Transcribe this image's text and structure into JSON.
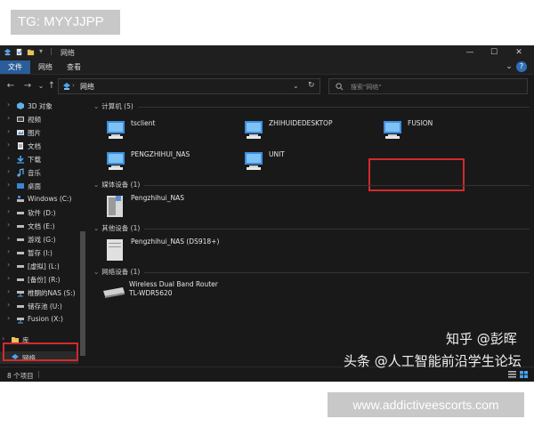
{
  "overlay": {
    "tg_label": "TG: MYYJJPP",
    "url_label": "www.addictiveescorts.com"
  },
  "window": {
    "title": "网络",
    "tabs": [
      "文件",
      "网络",
      "查看"
    ],
    "active_tab": 0
  },
  "address": {
    "crumb": "网络",
    "search_placeholder": "搜索\"网络\""
  },
  "sidebar": {
    "items": [
      {
        "label": "3D 对象",
        "icon": "3d-objects-icon"
      },
      {
        "label": "视频",
        "icon": "video-icon"
      },
      {
        "label": "图片",
        "icon": "pictures-icon"
      },
      {
        "label": "文档",
        "icon": "documents-icon"
      },
      {
        "label": "下载",
        "icon": "downloads-icon"
      },
      {
        "label": "音乐",
        "icon": "music-icon"
      },
      {
        "label": "桌面",
        "icon": "desktop-icon"
      },
      {
        "label": "Windows (C:)",
        "icon": "drive-icon"
      },
      {
        "label": "软件 (D:)",
        "icon": "drive-icon"
      },
      {
        "label": "文档 (E:)",
        "icon": "drive-icon"
      },
      {
        "label": "游戏 (G:)",
        "icon": "drive-icon"
      },
      {
        "label": "暂存 (I:)",
        "icon": "drive-icon"
      },
      {
        "label": "[虚拟] (L:)",
        "icon": "drive-icon"
      },
      {
        "label": "[备份] (R:)",
        "icon": "drive-icon"
      },
      {
        "label": "椎酮的NAS (S:)",
        "icon": "network-drive-icon"
      },
      {
        "label": "储存池 (U:)",
        "icon": "drive-icon"
      },
      {
        "label": "Fusion (X:)",
        "icon": "network-drive-icon"
      },
      {
        "label": "库",
        "icon": "library-icon"
      },
      {
        "label": "网络",
        "icon": "network-icon"
      }
    ]
  },
  "groups": {
    "computers": {
      "title": "计算机 (5)",
      "items": [
        "tsclient",
        "ZHIHUIDEDESKTOP",
        "FUSION",
        "PENGZHIHUI_NAS",
        "UNIT"
      ]
    },
    "media": {
      "title": "媒体设备 (1)",
      "items": [
        "Pengzhihui_NAS"
      ]
    },
    "other": {
      "title": "其他设备 (1)",
      "items": [
        "Pengzhihui_NAS (DS918+)"
      ]
    },
    "infra": {
      "title": "网络设备 (1)",
      "items": [
        "Wireless Dual Band Router",
        "TL-WDR5620"
      ]
    }
  },
  "status": {
    "item_count": "8 个项目"
  },
  "watermarks": {
    "zhihu": "知乎 @彭晖",
    "toutiao": "头条 @人工智能前沿学生论坛"
  },
  "colors": {
    "highlight_box": "#d42a2a",
    "active_tab": "#2b5d9a",
    "background": "#191919"
  }
}
